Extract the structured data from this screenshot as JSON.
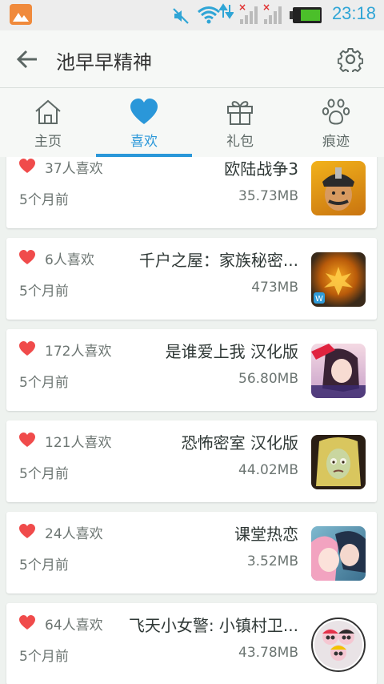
{
  "status_bar": {
    "time": "23:18",
    "icons": [
      "gallery-icon",
      "mute-icon",
      "wifi-icon",
      "signal-icon",
      "signal-icon",
      "battery-icon"
    ]
  },
  "header": {
    "title": "池早早精神",
    "back_icon": "back-arrow-icon",
    "settings_icon": "gear-icon"
  },
  "tabs": [
    {
      "label": "主页",
      "icon": "home-icon",
      "active": false
    },
    {
      "label": "喜欢",
      "icon": "heart-icon",
      "active": true
    },
    {
      "label": "礼包",
      "icon": "gift-icon",
      "active": false
    },
    {
      "label": "痕迹",
      "icon": "paw-icon",
      "active": false
    }
  ],
  "colors": {
    "accent": "#2a97d9",
    "heart": "#f04b4b",
    "time": "#2fa5d6"
  },
  "items": [
    {
      "likes": "37人喜欢",
      "name": "欧陆战争3",
      "age": "5个月前",
      "size": "35.73MB"
    },
    {
      "likes": "6人喜欢",
      "name": "千户之屋：家族秘密...",
      "age": "5个月前",
      "size": "473MB"
    },
    {
      "likes": "172人喜欢",
      "name": "是谁爱上我 汉化版",
      "age": "5个月前",
      "size": "56.80MB"
    },
    {
      "likes": "121人喜欢",
      "name": "恐怖密室 汉化版",
      "age": "5个月前",
      "size": "44.02MB"
    },
    {
      "likes": "24人喜欢",
      "name": "课堂热恋",
      "age": "5个月前",
      "size": "3.52MB"
    },
    {
      "likes": "64人喜欢",
      "name": "飞天小女警: 小镇村卫...",
      "age": "5个月前",
      "size": "43.78MB"
    }
  ]
}
